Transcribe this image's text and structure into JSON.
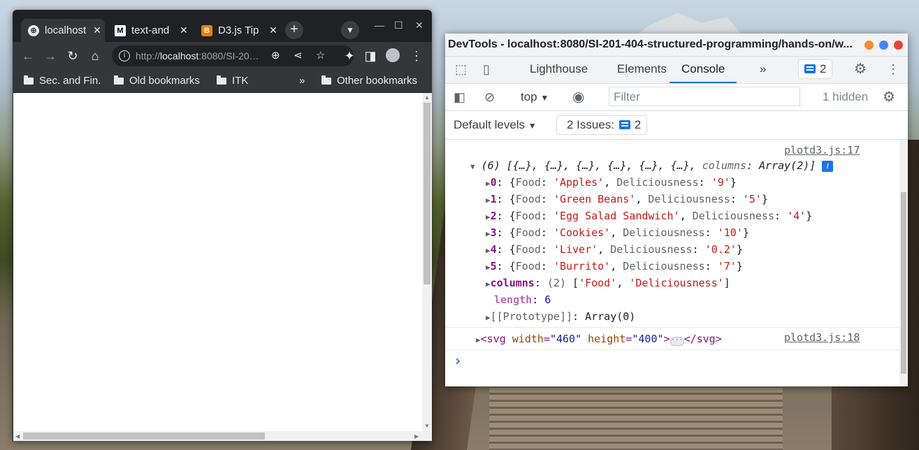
{
  "browser": {
    "tabs": [
      {
        "label": "localhost",
        "icon": "globe-icon",
        "active": true
      },
      {
        "label": "text-and",
        "icon": "medium-logo-icon",
        "active": false
      },
      {
        "label": "D3.js Tip",
        "icon": "blogger-logo-icon",
        "active": false
      }
    ],
    "url_prefix": "http://",
    "url_host": "localhost",
    "url_rest": ":8080/SI-20…",
    "bookmarks": [
      {
        "label": "Sec. and Fin."
      },
      {
        "label": "Old bookmarks"
      },
      {
        "label": "ITK"
      }
    ],
    "overflow": "»",
    "other_bookmarks": "Other bookmarks"
  },
  "devtools": {
    "title": "DevTools - localhost:8080/SI-201-404-structured-programming/hands-on/w...",
    "tabs": [
      "Lighthouse",
      "Elements",
      "Console"
    ],
    "selected_tab": "Console",
    "more": "»",
    "issues_badge_count": "2",
    "context": "top",
    "filter_placeholder": "Filter",
    "hidden_count": "1 hidden",
    "default_levels": "Default levels",
    "issues_label": "2 Issues:",
    "issues_count": "2",
    "console": {
      "msg1_source": "plotd3.js:17",
      "array_head": "(6) [{…}, {…}, {…}, {…}, {…}, {…},",
      "array_cols_key": "columns",
      "array_cols_val": "Array(2)]",
      "rows": [
        {
          "index": "0",
          "food": "'Apples'",
          "delic": "'9'"
        },
        {
          "index": "1",
          "food": "'Green Beans'",
          "delic": "'5'"
        },
        {
          "index": "2",
          "food": "'Egg Salad Sandwich'",
          "delic": "'4'"
        },
        {
          "index": "3",
          "food": "'Cookies'",
          "delic": "'10'"
        },
        {
          "index": "4",
          "food": "'Liver'",
          "delic": "'0.2'"
        },
        {
          "index": "5",
          "food": "'Burrito'",
          "delic": "'7'"
        }
      ],
      "columns_key": "columns",
      "columns_count": "(2)",
      "columns_v1": "'Food'",
      "columns_v2": "'Deliciousness'",
      "length_key": "length",
      "length_val": "6",
      "prototype": "[[Prototype]]",
      "prototype_val": "Array(0)",
      "msg2_source": "plotd3.js:18",
      "svg_width": "\"460\"",
      "svg_height": "\"400\"",
      "prompt": "›"
    }
  }
}
